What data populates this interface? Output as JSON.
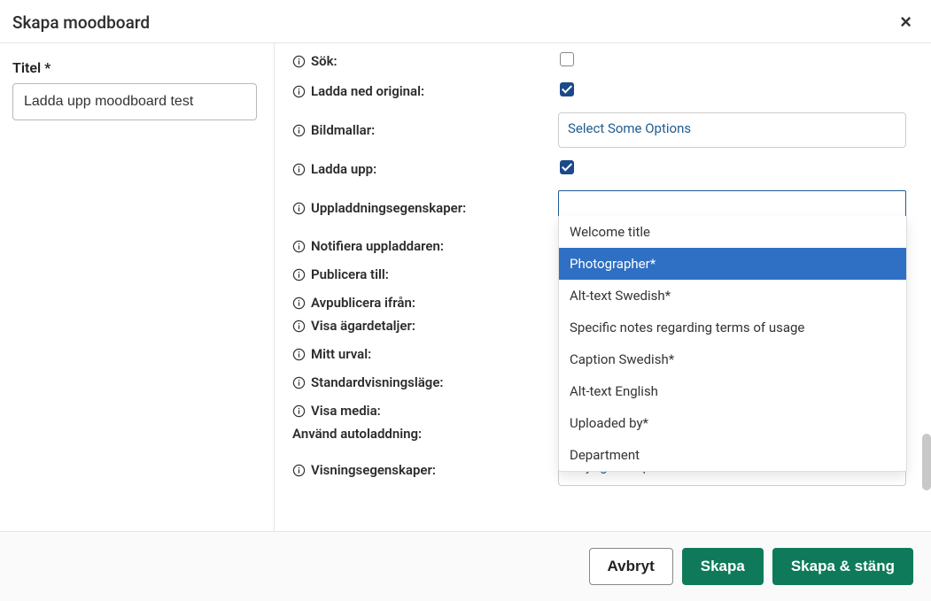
{
  "header": {
    "title": "Skapa moodboard",
    "close_label": "×"
  },
  "left": {
    "title_label": "Titel *",
    "title_value": "Ladda upp moodboard test"
  },
  "fields": {
    "sok": {
      "label": "Sök:"
    },
    "ladda_ned": {
      "label": "Ladda ned original:"
    },
    "bildmallar": {
      "label": "Bildmallar:",
      "placeholder": "Select Some Options"
    },
    "ladda_upp": {
      "label": "Ladda upp:"
    },
    "upload_props": {
      "label": "Uppladdningsegenskaper:"
    },
    "notify": {
      "label": "Notifiera uppladdaren:"
    },
    "publish_to": {
      "label": "Publicera till:"
    },
    "unpublish_from": {
      "label": "Avpublicera ifrån:"
    },
    "owner_details": {
      "label": "Visa ägardetaljer:"
    },
    "my_selection": {
      "label": "Mitt urval:"
    },
    "default_view": {
      "label": "Standardvisningsläge:"
    },
    "show_media": {
      "label": "Visa media:"
    },
    "autoload": {
      "label": "Använd autoladdning:"
    },
    "view_props": {
      "label": "Visningsegenskaper:",
      "placeholder": "Välj egenskaper"
    }
  },
  "dropdown": {
    "items": [
      "Welcome title",
      "Photographer*",
      "Alt-text Swedish*",
      "Specific notes regarding terms of usage",
      "Caption Swedish*",
      "Alt-text English",
      "Uploaded by*",
      "Department"
    ],
    "highlighted_index": 1
  },
  "footer": {
    "cancel": "Avbryt",
    "create": "Skapa",
    "create_close": "Skapa & stäng"
  }
}
